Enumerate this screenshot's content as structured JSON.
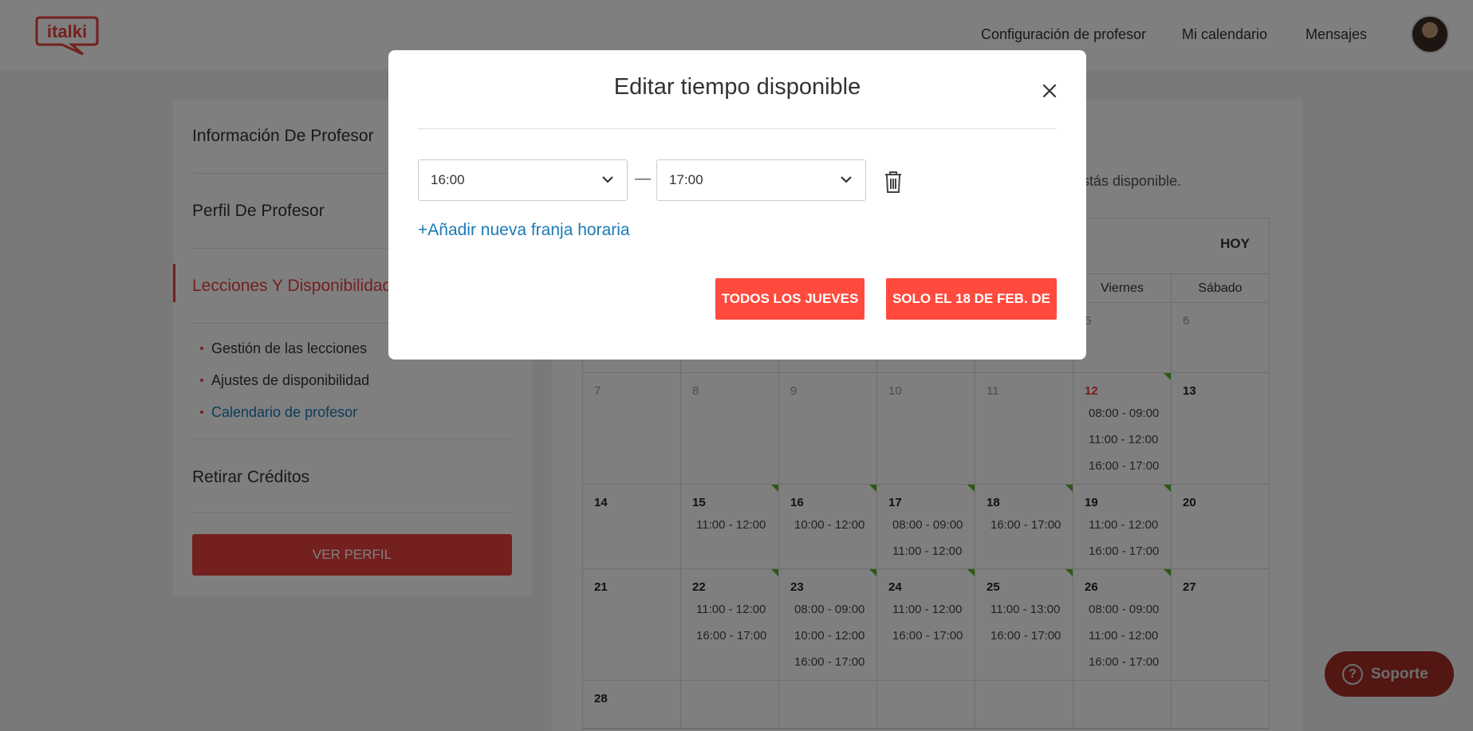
{
  "header": {
    "logo_text": "italki",
    "nav": [
      "Configuración de profesor",
      "Mi calendario",
      "Mensajes"
    ]
  },
  "sidebar": {
    "items": [
      "Información De Profesor",
      "Perfil De Profesor",
      "Lecciones Y Disponibilidad",
      "Retirar Créditos"
    ],
    "sub_items": [
      "Gestión de las lecciones",
      "Ajustes de disponibilidad",
      "Calendario de profesor"
    ],
    "button": "VER PERFIL"
  },
  "main": {
    "subtitle": "e estás disponible.",
    "today": "HOY",
    "day_headers": [
      "",
      "",
      "",
      "",
      "",
      "Viernes",
      "Sábado"
    ],
    "weeks": [
      {
        "days": [
          {
            "n": ""
          },
          {
            "n": ""
          },
          {
            "n": ""
          },
          {
            "n": ""
          },
          {
            "n": ""
          },
          {
            "n": "5"
          },
          {
            "n": "6"
          }
        ]
      },
      {
        "days": [
          {
            "n": "7"
          },
          {
            "n": "8"
          },
          {
            "n": "9"
          },
          {
            "n": "10"
          },
          {
            "n": "11"
          },
          {
            "n": "12",
            "slots": [
              "08:00 - 09:00",
              "11:00 - 12:00",
              "16:00 - 17:00"
            ]
          },
          {
            "n": "13"
          }
        ]
      },
      {
        "days": [
          {
            "n": "14"
          },
          {
            "n": "15",
            "slots": [
              "11:00 - 12:00"
            ]
          },
          {
            "n": "16",
            "slots": [
              "10:00 - 12:00"
            ]
          },
          {
            "n": "17",
            "slots": [
              "08:00 - 09:00",
              "11:00 - 12:00"
            ]
          },
          {
            "n": "18",
            "slots": [
              "16:00 - 17:00"
            ]
          },
          {
            "n": "19",
            "slots": [
              "11:00 - 12:00",
              "16:00 - 17:00"
            ]
          },
          {
            "n": "20"
          }
        ]
      },
      {
        "days": [
          {
            "n": "21"
          },
          {
            "n": "22",
            "slots": [
              "11:00 - 12:00",
              "16:00 - 17:00"
            ]
          },
          {
            "n": "23",
            "slots": [
              "08:00 - 09:00",
              "10:00 - 12:00",
              "16:00 - 17:00"
            ]
          },
          {
            "n": "24",
            "slots": [
              "11:00 - 12:00",
              "16:00 - 17:00"
            ]
          },
          {
            "n": "25",
            "slots": [
              "11:00 - 13:00",
              "16:00 - 17:00"
            ]
          },
          {
            "n": "26",
            "slots": [
              "08:00 - 09:00",
              "11:00 - 12:00",
              "16:00 - 17:00"
            ]
          },
          {
            "n": "27"
          }
        ]
      },
      {
        "days": [
          {
            "n": "28"
          },
          {
            "n": ""
          },
          {
            "n": ""
          },
          {
            "n": ""
          },
          {
            "n": ""
          },
          {
            "n": ""
          },
          {
            "n": ""
          }
        ]
      }
    ]
  },
  "modal": {
    "title": "Editar tiempo disponible",
    "start_time": "16:00",
    "separator": "—",
    "end_time": "17:00",
    "add_slot": "+Añadir nueva franja horaria",
    "btn_all": "TODOS LOS JUEVES",
    "btn_only": "SOLO EL 18 DE FEB. DE"
  },
  "support": {
    "label": "Soporte",
    "icon": "?"
  },
  "colors": {
    "accent": "#e9413d",
    "button_red": "#ff4a3d",
    "link_blue": "#1a7ab5",
    "available_green": "#59b32a"
  }
}
